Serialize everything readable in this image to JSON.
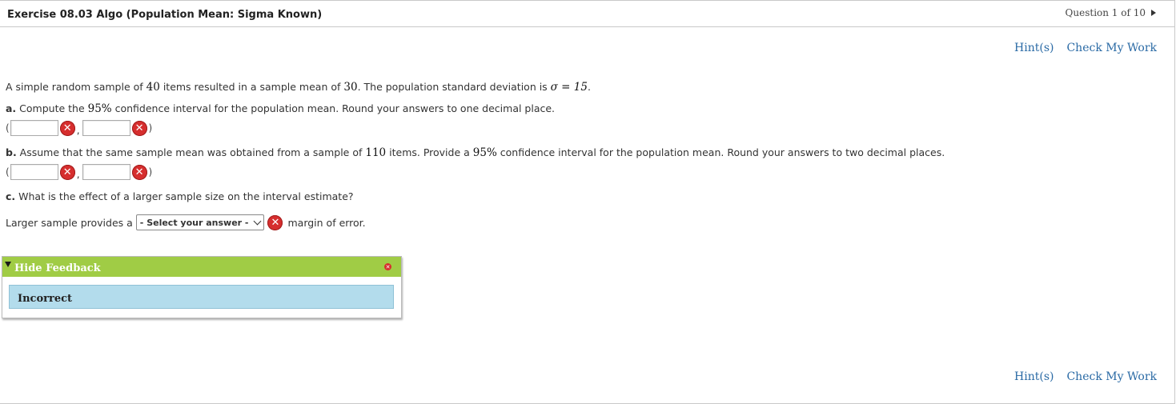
{
  "header": {
    "title": "Exercise 08.03 Algo (Population Mean: Sigma Known)",
    "question_nav": "Question 1 of 10"
  },
  "links": {
    "hints": "Hint(s)",
    "check": "Check My Work"
  },
  "problem": {
    "intro_1": "A simple random sample of ",
    "n": "40",
    "intro_2": " items resulted in a sample mean of ",
    "mean": "30",
    "intro_3": ". The population standard deviation is ",
    "sigma_expr": "σ = 15",
    "intro_4": "."
  },
  "part_a": {
    "label": "a.",
    "text_1": " Compute the ",
    "conf": "95%",
    "text_2": " confidence interval for the population mean. Round your answers to one decimal place.",
    "lower_value": "",
    "upper_value": ""
  },
  "part_b": {
    "label": "b.",
    "text_1": " Assume that the same sample mean was obtained from a sample of ",
    "n": "110",
    "text_2": " items. Provide a ",
    "conf": "95%",
    "text_3": " confidence interval for the population mean. Round your answers to two decimal places.",
    "lower_value": "",
    "upper_value": ""
  },
  "part_c": {
    "label": "c.",
    "text": " What is the effect of a larger sample size on the interval estimate?",
    "answer_prefix": "Larger sample provides a",
    "select_value": "- Select your answer -",
    "answer_suffix": "margin of error."
  },
  "interval": {
    "open": "(",
    "comma": ",",
    "close": ")"
  },
  "feedback": {
    "header": "Hide Feedback",
    "message": "Incorrect"
  },
  "colors": {
    "link": "#2a6aa5",
    "error": "#d62e2e",
    "feedback_header": "#a0cc45",
    "feedback_body": "#b3dcec"
  },
  "icons": {
    "error": "x-circle-icon",
    "nav_next": "triangle-right-icon",
    "collapse": "triangle-down-icon",
    "close": "close-icon"
  }
}
